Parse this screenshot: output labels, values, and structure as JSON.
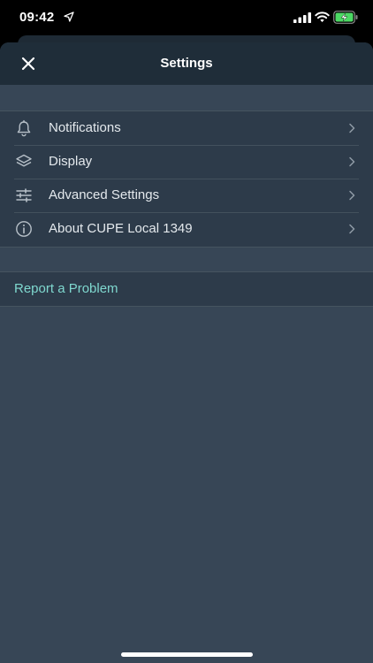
{
  "status_bar": {
    "time": "09:42",
    "location_icon": "location-arrow-icon",
    "signal_icon": "cellular-signal-icon",
    "wifi_icon": "wifi-icon",
    "battery_icon": "battery-charging-icon"
  },
  "nav": {
    "title": "Settings",
    "close_icon": "close-icon"
  },
  "settings": {
    "items": [
      {
        "label": "Notifications",
        "icon": "bell-icon"
      },
      {
        "label": "Display",
        "icon": "layers-icon"
      },
      {
        "label": "Advanced Settings",
        "icon": "sliders-icon"
      },
      {
        "label": "About CUPE Local 1349",
        "icon": "info-icon"
      }
    ]
  },
  "report": {
    "label": "Report a Problem"
  },
  "colors": {
    "nav_background": "#1f2d39",
    "sheet_background": "#374656",
    "group_background": "#2d3b4a",
    "accent": "#7fd8cf",
    "battery_green": "#4cd964"
  }
}
